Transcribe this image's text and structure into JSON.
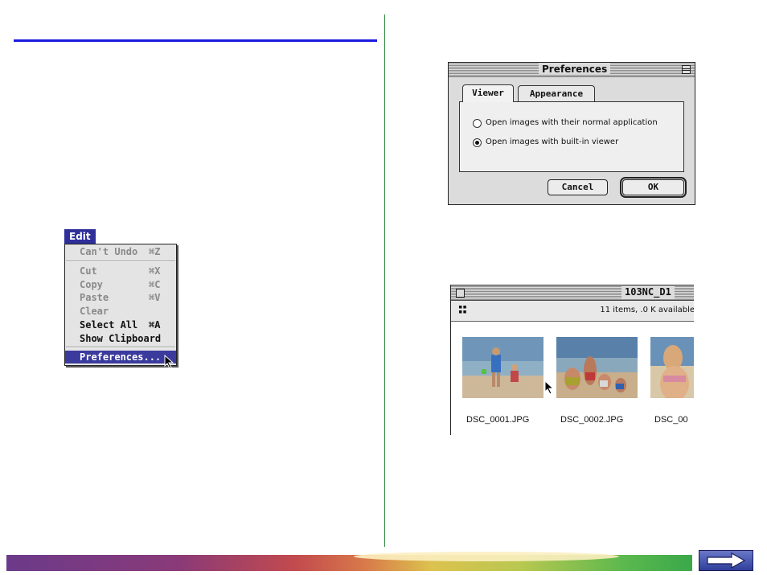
{
  "edit_menu": {
    "title": "Edit",
    "items": [
      {
        "label": "Can't Undo",
        "shortcut": "⌘Z",
        "enabled": false
      },
      {
        "label": "Cut",
        "shortcut": "⌘X",
        "enabled": false
      },
      {
        "label": "Copy",
        "shortcut": "⌘C",
        "enabled": false
      },
      {
        "label": "Paste",
        "shortcut": "⌘V",
        "enabled": false
      },
      {
        "label": "Clear",
        "shortcut": "",
        "enabled": false
      },
      {
        "label": "Select All",
        "shortcut": "⌘A",
        "enabled": true
      },
      {
        "label": "Show Clipboard",
        "shortcut": "",
        "enabled": true
      },
      {
        "label": "Preferences...",
        "shortcut": "",
        "enabled": true,
        "highlighted": true
      }
    ]
  },
  "preferences_dialog": {
    "title": "Preferences",
    "tabs": [
      {
        "label": "Viewer",
        "active": true
      },
      {
        "label": "Appearance",
        "active": false
      }
    ],
    "options": [
      {
        "label": "Open images with their normal application",
        "selected": false
      },
      {
        "label": "Open images with built-in viewer",
        "selected": true
      }
    ],
    "cancel_label": "Cancel",
    "ok_label": "OK"
  },
  "finder_window": {
    "title": "103NC_D1",
    "info": "11 items, .0 K available",
    "files": [
      {
        "name": "DSC_0001.JPG"
      },
      {
        "name": "DSC_0002.JPG"
      },
      {
        "name": "DSC_00"
      }
    ]
  },
  "colors": {
    "accent_rule": "#1a1ae0",
    "divider": "#2f8a3d",
    "menu_highlight": "#3b3b9e"
  },
  "icons": {
    "next": "right-arrow-icon",
    "cursor": "arrow-cursor-icon"
  }
}
